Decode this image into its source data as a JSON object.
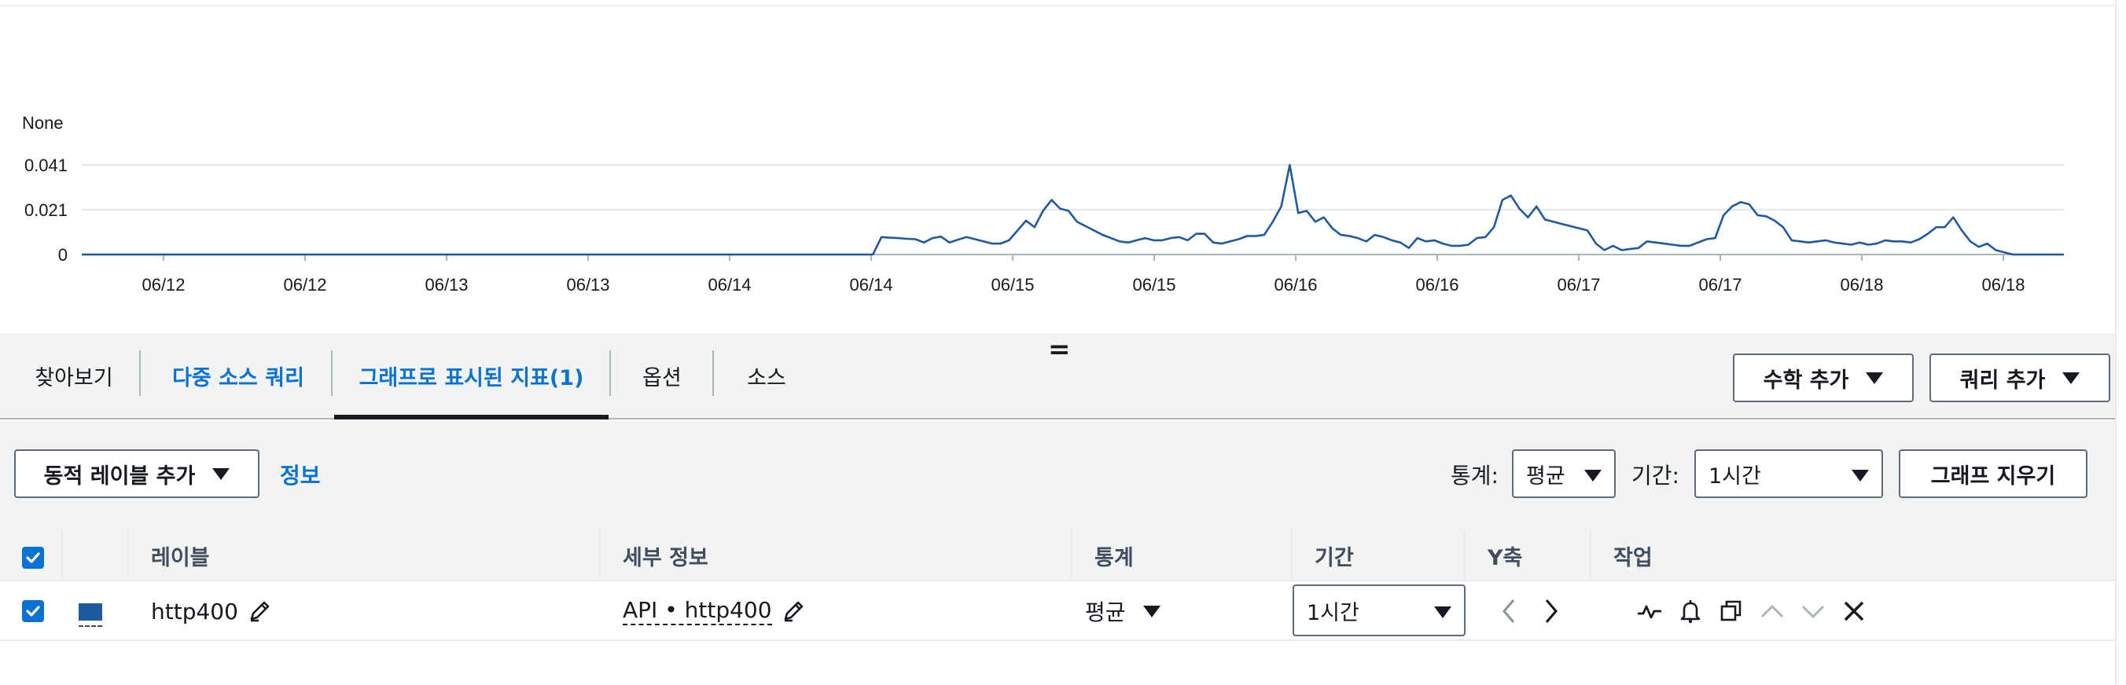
{
  "chart_data": {
    "type": "line",
    "ylabel": "None",
    "y_ticks": [
      "0.041",
      "0.021",
      "0"
    ],
    "ylim": [
      0,
      0.0425
    ],
    "x_tick_labels": [
      "06/12",
      "06/12",
      "06/13",
      "06/13",
      "06/14",
      "06/14",
      "06/15",
      "06/15",
      "06/16",
      "06/16",
      "06/17",
      "06/17",
      "06/18",
      "06/18"
    ],
    "grid": true,
    "series": [
      {
        "name": "http400",
        "color": "#1f5aa0",
        "values": [
          0,
          0,
          0,
          0,
          0,
          0,
          0,
          0,
          0,
          0,
          0,
          0,
          0,
          0,
          0,
          0,
          0,
          0,
          0,
          0,
          0,
          0,
          0,
          0,
          0,
          0,
          0,
          0,
          0,
          0,
          0,
          0,
          0,
          0,
          0,
          0,
          0,
          0,
          0,
          0,
          0,
          0,
          0,
          0,
          0,
          0,
          0,
          0,
          0,
          0,
          0,
          0,
          0,
          0,
          0,
          0,
          0,
          0,
          0,
          0,
          0,
          0,
          0,
          0,
          0,
          0,
          0,
          0,
          0,
          0,
          0,
          0,
          0,
          0,
          0,
          0,
          0,
          0,
          0,
          0,
          0,
          0,
          0,
          0,
          0,
          0,
          0,
          0,
          0,
          0,
          0,
          0,
          0,
          0,
          0.008,
          0.0077,
          0.0075,
          0.0072,
          0.007,
          0.0055,
          0.0075,
          0.0082,
          0.0055,
          0.0068,
          0.008,
          0.007,
          0.006,
          0.005,
          0.005,
          0.0065,
          0.011,
          0.0155,
          0.0125,
          0.02,
          0.025,
          0.021,
          0.02,
          0.015,
          0.013,
          0.011,
          0.009,
          0.0075,
          0.006,
          0.0055,
          0.0065,
          0.0075,
          0.0065,
          0.0065,
          0.0075,
          0.008,
          0.0065,
          0.0095,
          0.0095,
          0.0055,
          0.005,
          0.006,
          0.007,
          0.0085,
          0.0085,
          0.009,
          0.015,
          0.022,
          0.041,
          0.019,
          0.02,
          0.015,
          0.017,
          0.012,
          0.009,
          0.0085,
          0.0075,
          0.006,
          0.009,
          0.008,
          0.0065,
          0.0055,
          0.003,
          0.0075,
          0.006,
          0.0065,
          0.005,
          0.004,
          0.004,
          0.0045,
          0.0075,
          0.008,
          0.0125,
          0.025,
          0.027,
          0.021,
          0.017,
          0.022,
          0.016,
          0.015,
          0.014,
          0.013,
          0.012,
          0.011,
          0.005,
          0.002,
          0.004,
          0.002,
          0.0025,
          0.003,
          0.006,
          0.0055,
          0.005,
          0.0045,
          0.004,
          0.004,
          0.0055,
          0.007,
          0.0075,
          0.018,
          0.022,
          0.024,
          0.023,
          0.018,
          0.0175,
          0.0155,
          0.0125,
          0.0065,
          0.006,
          0.0055,
          0.006,
          0.0065,
          0.0055,
          0.005,
          0.0045,
          0.0055,
          0.0045,
          0.005,
          0.0065,
          0.006,
          0.006,
          0.0055,
          0.007,
          0.0095,
          0.0125,
          0.0125,
          0.017,
          0.011,
          0.006,
          0.0035,
          0.005,
          0.002,
          0.001,
          0,
          0,
          0,
          0,
          0,
          0,
          0
        ]
      }
    ]
  },
  "tabs": {
    "browse": "찾아보기",
    "multi_source": "다중 소스 쿼리",
    "graphed_metrics": "그래프로 표시된 지표(1)",
    "options": "옵션",
    "source": "소스",
    "resize_handle": "="
  },
  "actions": {
    "add_math": "수학 추가",
    "add_query": "쿼리 추가",
    "add_dynamic_label": "동적 레이블 추가",
    "info_link": "정보",
    "stat_label": "통계:",
    "stat_value": "평균",
    "period_label": "기간:",
    "period_value": "1시간",
    "clear_graph": "그래프 지우기"
  },
  "table": {
    "headers": {
      "label": "레이블",
      "details": "세부 정보",
      "statistic": "통계",
      "period": "기간",
      "y_axis": "Y축",
      "actions": "작업"
    },
    "rows": [
      {
        "label": "http400",
        "details": "API • http400",
        "statistic": "평균",
        "period": "1시간",
        "color": "#1f5aa0"
      }
    ]
  },
  "colors": {
    "accent": "#0972d3",
    "series": "#1f5aa0",
    "panel_bg": "#f2f3f3"
  }
}
